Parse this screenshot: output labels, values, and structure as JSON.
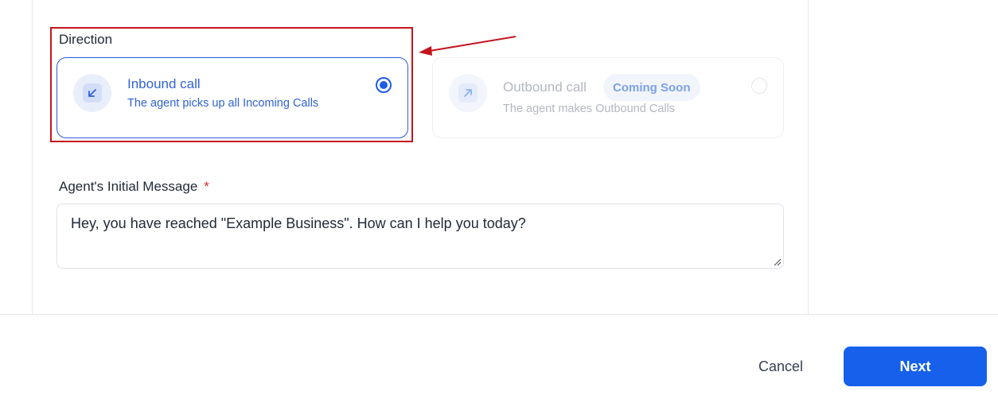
{
  "direction": {
    "label": "Direction",
    "inbound": {
      "title": "Inbound call",
      "description": "The agent picks up all Incoming Calls",
      "selected": true,
      "icon": "arrow-down-left-icon"
    },
    "outbound": {
      "title": "Outbound call",
      "badge": "Coming Soon",
      "description": "The agent makes Outbound Calls",
      "selected": false,
      "icon": "arrow-up-right-icon"
    }
  },
  "initial_message": {
    "label": "Agent's Initial Message",
    "required_mark": "*",
    "value": "Hey, you have reached \"Example Business\". How can I help you today?"
  },
  "footer": {
    "cancel_label": "Cancel",
    "next_label": "Next"
  },
  "colors": {
    "accent": "#1760ec",
    "annotation": "#c4141b",
    "selected_text": "#2f63d6"
  }
}
